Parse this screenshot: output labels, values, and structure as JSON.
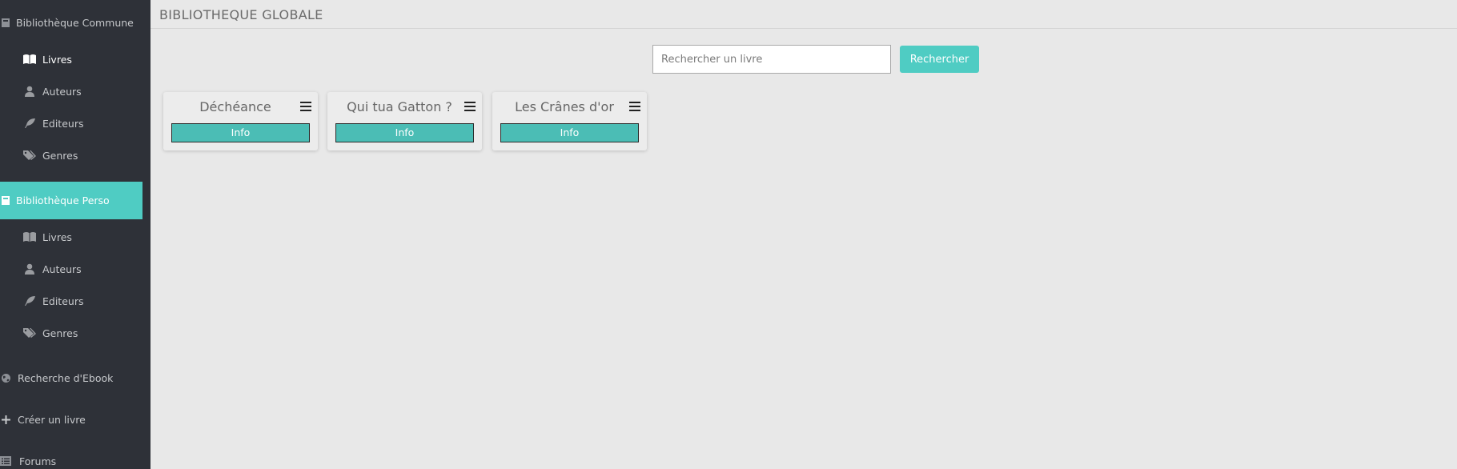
{
  "header": {
    "title": "BIBLIOTHEQUE GLOBALE"
  },
  "sidebar": {
    "common": {
      "label": "Bibliothèque Commune",
      "items": [
        {
          "label": "Livres",
          "icon": "book-icon"
        },
        {
          "label": "Auteurs",
          "icon": "user-icon"
        },
        {
          "label": "Editeurs",
          "icon": "feather-icon"
        },
        {
          "label": "Genres",
          "icon": "tags-icon"
        }
      ]
    },
    "perso": {
      "label": "Bibliothèque Perso",
      "items": [
        {
          "label": "Livres",
          "icon": "book-icon"
        },
        {
          "label": "Auteurs",
          "icon": "user-icon"
        },
        {
          "label": "Editeurs",
          "icon": "feather-icon"
        },
        {
          "label": "Genres",
          "icon": "tags-icon"
        }
      ]
    },
    "ebook_search": {
      "label": "Recherche d'Ebook",
      "icon": "globe-icon"
    },
    "create_book": {
      "label": "Créer un livre",
      "icon": "plus-icon"
    },
    "forums": {
      "label": "Forums",
      "icon": "list-icon"
    }
  },
  "search": {
    "placeholder": "Rechercher un livre",
    "value": "",
    "button_label": "Rechercher"
  },
  "books": [
    {
      "title": "Déchéance",
      "info_label": "Info"
    },
    {
      "title": "Qui tua Gatton ?",
      "info_label": "Info"
    },
    {
      "title": "Les Crânes d'or",
      "info_label": "Info"
    }
  ],
  "colors": {
    "accent": "#4fccc3",
    "sidebar_bg": "#2e3138",
    "content_bg": "#e8e8e8"
  }
}
